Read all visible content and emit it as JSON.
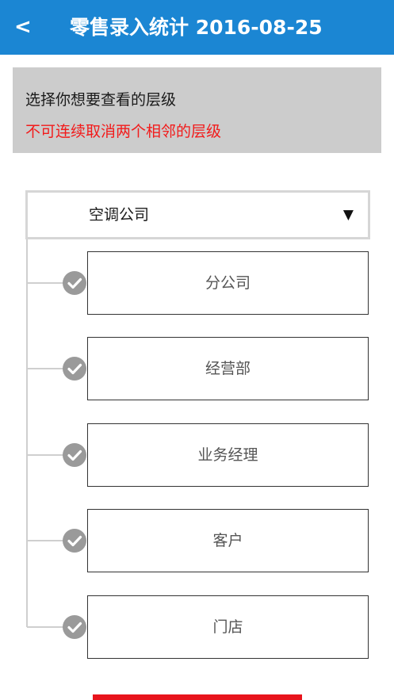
{
  "header": {
    "back_label": "<",
    "title": "零售录入统计 2016-08-25"
  },
  "notice": {
    "line1": "选择你想要查看的层级",
    "line2": "不可连续取消两个相邻的层级"
  },
  "dropdown": {
    "selected": "空调公司",
    "arrow": "▼"
  },
  "levels": [
    {
      "label": "分公司",
      "checked": true
    },
    {
      "label": "经营部",
      "checked": true
    },
    {
      "label": "业务经理",
      "checked": true
    },
    {
      "label": "客户",
      "checked": true
    },
    {
      "label": "门店",
      "checked": true
    }
  ],
  "colors": {
    "header_bg": "#1b86d3",
    "notice_bg": "#cccccc",
    "warning_text": "#f21b1b",
    "check_bg": "#9a9a9a",
    "bottom_button": "#e8141c"
  },
  "icons": {
    "back": "chevron-left-icon",
    "dropdown": "caret-down-icon",
    "check": "checkmark-circle-icon"
  }
}
